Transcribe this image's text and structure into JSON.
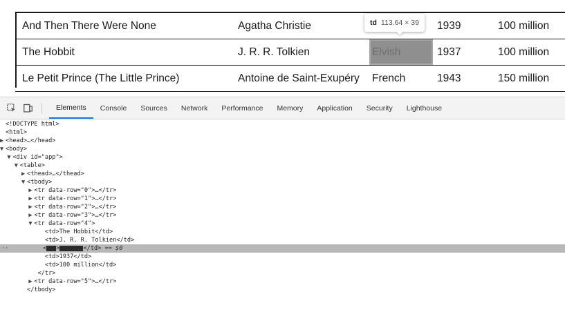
{
  "books_table": {
    "rows": [
      {
        "title": "And Then There Were None",
        "author": "Agatha Christie",
        "language": "",
        "year": "1939",
        "sales": "100 million"
      },
      {
        "title": "The Hobbit",
        "author": "J. R. R. Tolkien",
        "language": "Elvish",
        "year": "1937",
        "sales": "100 million"
      },
      {
        "title": "Le Petit Prince (The Little Prince)",
        "author": "Antoine de Saint-Exupéry",
        "language": "French",
        "year": "1943",
        "sales": "150 million"
      }
    ]
  },
  "tooltip": {
    "tag": "td",
    "dimensions": "113.64 × 39"
  },
  "devtools": {
    "tabs": [
      "Elements",
      "Console",
      "Sources",
      "Network",
      "Performance",
      "Memory",
      "Application",
      "Security",
      "Lighthouse"
    ],
    "active_tab": "Elements",
    "dom_lines": [
      {
        "indent": "",
        "tri": "",
        "text": "<!DOCTYPE html>"
      },
      {
        "indent": "",
        "tri": "",
        "text": "<html>"
      },
      {
        "indent": "",
        "tri": "▶",
        "text": "<head>…</head>"
      },
      {
        "indent": "",
        "tri": "▼",
        "text": "<body>"
      },
      {
        "indent": "  ",
        "tri": "▼",
        "text": "<div id=\"app\">"
      },
      {
        "indent": "    ",
        "tri": "▼",
        "text": "<table>"
      },
      {
        "indent": "      ",
        "tri": "▶",
        "text": "<thead>…</thead>"
      },
      {
        "indent": "      ",
        "tri": "▼",
        "text": "<tbody>"
      },
      {
        "indent": "        ",
        "tri": "▶",
        "text": "<tr data-row=\"0\">…</tr>"
      },
      {
        "indent": "        ",
        "tri": "▶",
        "text": "<tr data-row=\"1\">…</tr>"
      },
      {
        "indent": "        ",
        "tri": "▶",
        "text": "<tr data-row=\"2\">…</tr>"
      },
      {
        "indent": "        ",
        "tri": "▶",
        "text": "<tr data-row=\"3\">…</tr>"
      },
      {
        "indent": "        ",
        "tri": "▼",
        "text": "<tr data-row=\"4\">"
      },
      {
        "indent": "           ",
        "tri": "",
        "text": "<td>The Hobbit</td>"
      },
      {
        "indent": "           ",
        "tri": "",
        "text": "<td>J. R. R. Tolkien</td>"
      }
    ],
    "selected_line": {
      "indent": "           ",
      "prefix": "<",
      "close": "</td>",
      "suffix": " == $0",
      "gutter": "··"
    },
    "dom_lines_after": [
      {
        "indent": "           ",
        "tri": "",
        "text": "<td>1937</td>"
      },
      {
        "indent": "           ",
        "tri": "",
        "text": "<td>100 million</td>"
      },
      {
        "indent": "         ",
        "tri": "",
        "text": "</tr>"
      },
      {
        "indent": "        ",
        "tri": "▶",
        "text": "<tr data-row=\"5\">…</tr>"
      },
      {
        "indent": "      ",
        "tri": "",
        "text": "</tbody>"
      }
    ]
  }
}
